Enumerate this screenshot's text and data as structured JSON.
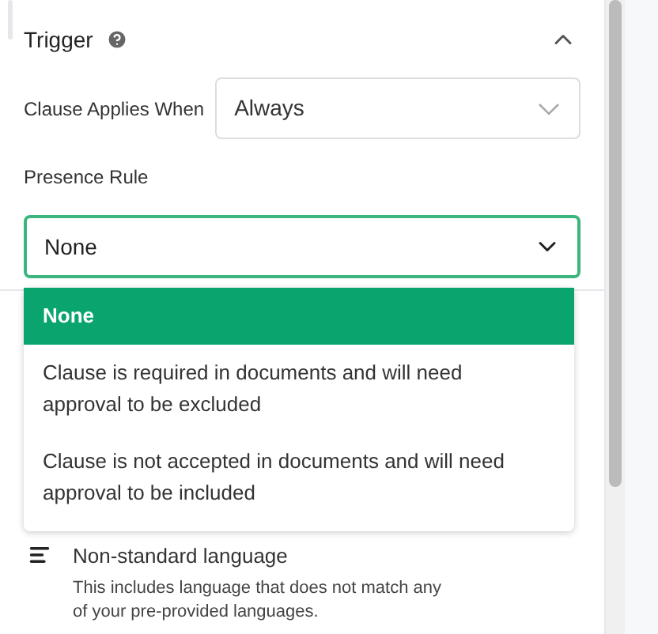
{
  "section": {
    "title": "Trigger",
    "expanded": true
  },
  "clause_applies": {
    "label": "Clause Applies When",
    "value": "Always"
  },
  "presence_rule": {
    "label": "Presence Rule",
    "value": "None",
    "open": true,
    "options": [
      {
        "label": "None",
        "selected": true
      },
      {
        "label": "Clause is required in documents and will need approval to be excluded",
        "selected": false
      },
      {
        "label": "Clause is not accepted in documents and will need approval to be included",
        "selected": false
      }
    ]
  },
  "item": {
    "title": "Non-standard language",
    "description": "This includes language that does not match any of your pre-provided languages."
  }
}
